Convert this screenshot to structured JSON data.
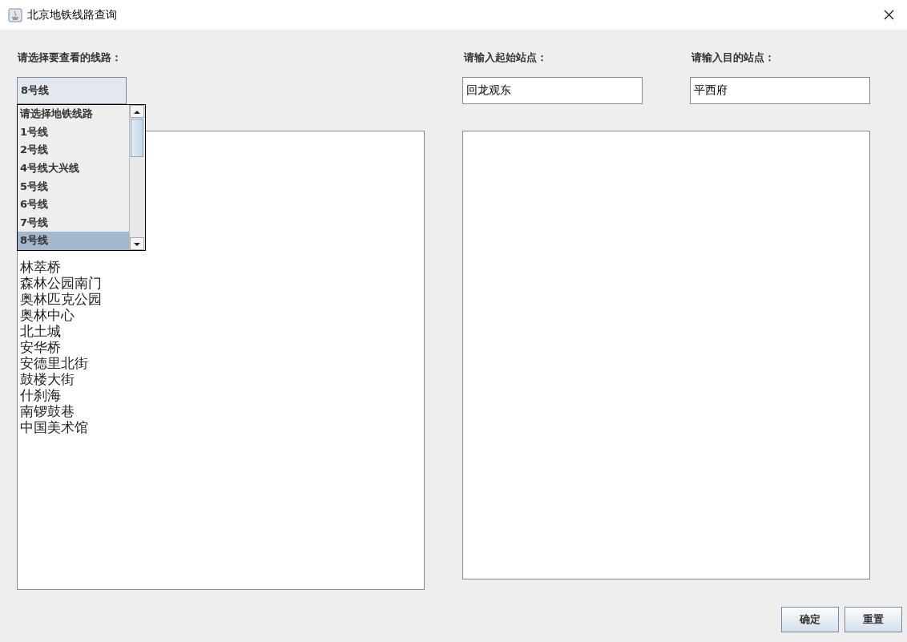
{
  "window": {
    "title": "北京地铁线路查询"
  },
  "line_picker": {
    "label": "请选择要查看的线路：",
    "value": "8号线",
    "expanded": true,
    "options": [
      {
        "label": "请选择地铁线路",
        "selected": false
      },
      {
        "label": "1号线",
        "selected": false
      },
      {
        "label": "2号线",
        "selected": false
      },
      {
        "label": "4号线大兴线",
        "selected": false
      },
      {
        "label": "5号线",
        "selected": false
      },
      {
        "label": "6号线",
        "selected": false
      },
      {
        "label": "7号线",
        "selected": false
      },
      {
        "label": "8号线",
        "selected": true
      }
    ]
  },
  "stations": [
    "林萃桥",
    "森林公园南门",
    "奥林匹克公园",
    "奥林中心",
    "北土城",
    "安华桥",
    "安德里北街",
    "鼓楼大街",
    "什刹海",
    "南锣鼓巷",
    "中国美术馆"
  ],
  "start": {
    "label": "请输入起始站点：",
    "value": "回龙观东"
  },
  "end": {
    "label": "请输入目的站点：",
    "value": "平西府"
  },
  "buttons": [
    "确定",
    "重置"
  ]
}
